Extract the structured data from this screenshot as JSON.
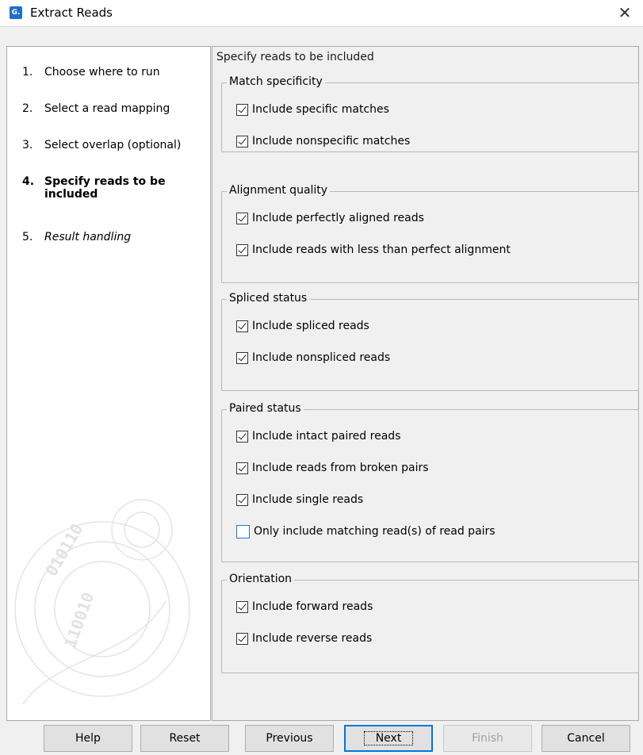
{
  "window": {
    "title": "Extract Reads",
    "close_glyph": "✕"
  },
  "steps": [
    {
      "num": "1.",
      "label": "Choose where to run"
    },
    {
      "num": "2.",
      "label": "Select a read mapping"
    },
    {
      "num": "3.",
      "label": "Select overlap (optional)"
    },
    {
      "num": "4.",
      "label": "Specify reads to be included"
    },
    {
      "num": "5.",
      "label": "Result handling"
    }
  ],
  "content": {
    "header": "Specify reads to be included",
    "groups": [
      {
        "title": "Match specificity",
        "options": [
          {
            "label": "Include specific matches",
            "checked": true
          },
          {
            "label": "Include nonspecific matches",
            "checked": true
          }
        ]
      },
      {
        "title": "Alignment quality",
        "options": [
          {
            "label": "Include perfectly aligned reads",
            "checked": true
          },
          {
            "label": "Include reads with less than perfect alignment",
            "checked": true
          }
        ]
      },
      {
        "title": "Spliced status",
        "options": [
          {
            "label": "Include spliced reads",
            "checked": true
          },
          {
            "label": "Include nonspliced reads",
            "checked": true
          }
        ]
      },
      {
        "title": "Paired status",
        "options": [
          {
            "label": "Include intact paired reads",
            "checked": true
          },
          {
            "label": "Include reads from broken pairs",
            "checked": true
          },
          {
            "label": "Include single reads",
            "checked": true
          },
          {
            "label": "Only include matching read(s) of read pairs",
            "checked": false
          }
        ]
      },
      {
        "title": "Orientation",
        "options": [
          {
            "label": "Include forward reads",
            "checked": true
          },
          {
            "label": "Include reverse reads",
            "checked": true
          }
        ]
      }
    ]
  },
  "buttons": {
    "help": "Help",
    "reset": "Reset",
    "previous": "Previous",
    "next": "Next",
    "finish": "Finish",
    "cancel": "Cancel"
  },
  "colors": {
    "accent": "#0078d7",
    "checkbox_focus": "#1e7ad6"
  }
}
